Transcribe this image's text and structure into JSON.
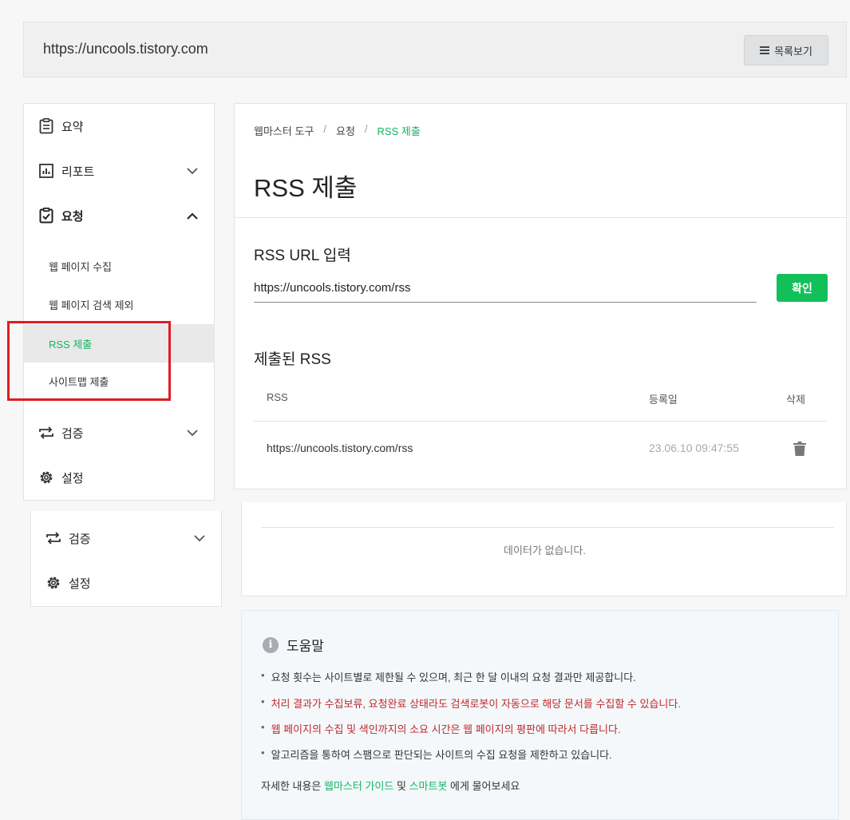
{
  "header": {
    "site_url": "https://uncools.tistory.com",
    "list_button": "목록보기"
  },
  "sidebar": {
    "items": [
      {
        "label": "요약",
        "icon": "clipboard-icon"
      },
      {
        "label": "리포트",
        "icon": "bar-chart-icon"
      },
      {
        "label": "요청",
        "icon": "checkbox-clipboard-icon"
      },
      {
        "label": "검증",
        "icon": "repeat-arrows-icon"
      },
      {
        "label": "설정",
        "icon": "gear-icon"
      }
    ],
    "sub_items": [
      "웹 페이지 수집",
      "웹 페이지 검색 제외",
      "RSS 제출",
      "사이트맵 제출"
    ],
    "active_sub": "RSS 제출"
  },
  "sidebar_duplicate": {
    "items": [
      {
        "label": "검증",
        "icon": "repeat-arrows-icon"
      },
      {
        "label": "설정",
        "icon": "gear-icon"
      }
    ]
  },
  "main": {
    "breadcrumb": [
      "웹마스터 도구",
      "요청",
      "RSS 제출"
    ],
    "breadcrumb_sep": "/",
    "title": "RSS 제출",
    "rss_input": {
      "label": "RSS URL 입력",
      "value": "https://uncools.tistory.com/rss",
      "button": "확인"
    },
    "submitted": {
      "label": "제출된 RSS",
      "columns": [
        "RSS",
        "등록일",
        "삭제"
      ],
      "rows": [
        {
          "rss": "https://uncools.tistory.com/rss",
          "date": "23.06.10 09:47:55"
        }
      ]
    }
  },
  "panel2": {
    "empty_text": "데이터가 없습니다."
  },
  "help": {
    "title": "도움말",
    "items": [
      {
        "text": "요청 횟수는 사이트별로 제한될 수 있으며, 최근 한 달 이내의 요청 결과만 제공합니다.",
        "warn": false
      },
      {
        "text": "처리 결과가 수집보류, 요청완료 상태라도 검색로봇이 자동으로 해당 문서를 수집할 수 있습니다.",
        "warn": true
      },
      {
        "text": "웹 페이지의 수집 및 색인까지의 소요 시간은 웹 페이지의 평판에 따라서 다릅니다.",
        "warn": true
      },
      {
        "text": "알고리즘을 통하여 스팸으로 판단되는 사이트의 수집 요청을 제한하고 있습니다.",
        "warn": false
      }
    ],
    "footer_prefix": "자세한 내용은",
    "footer_link1": "웹마스터 가이드",
    "footer_mid": "및",
    "footer_link2": "스마트봇",
    "footer_suffix": "에게 물어보세요"
  },
  "colors": {
    "accent": "#12c05a",
    "active_text": "#12b564",
    "warning_text": "#c0282d",
    "highlight_box": "#e11b22"
  }
}
